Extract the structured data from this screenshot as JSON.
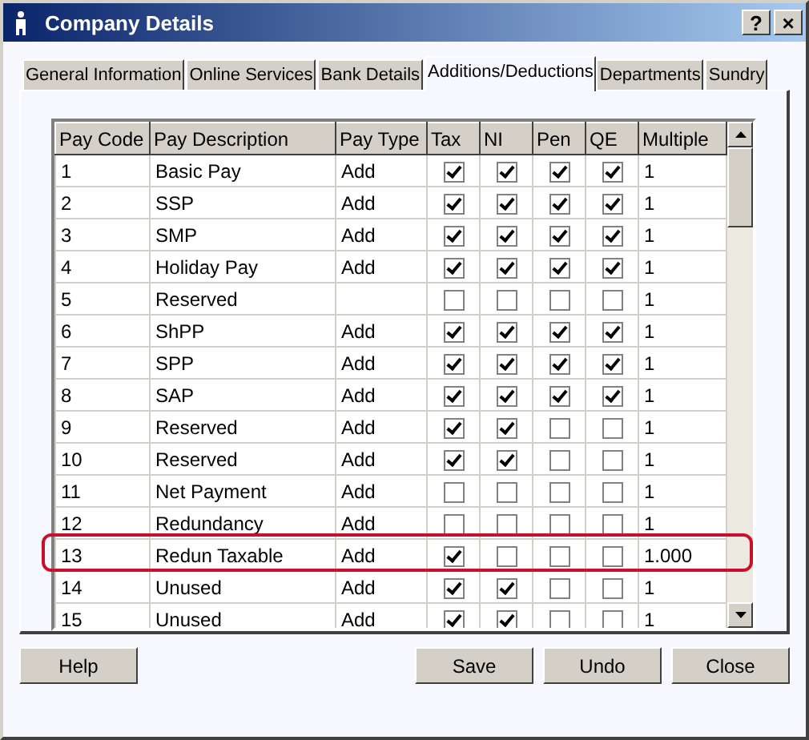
{
  "window": {
    "title": "Company Details",
    "buttons": [
      "?",
      "×"
    ]
  },
  "tabs": [
    {
      "label": "General Information",
      "selected": false
    },
    {
      "label": "Online Services",
      "selected": false
    },
    {
      "label": "Bank Details",
      "selected": false
    },
    {
      "label": "Additions/Deductions",
      "selected": true
    },
    {
      "label": "Departments",
      "selected": false
    },
    {
      "label": "Sundry",
      "selected": false
    }
  ],
  "table": {
    "columns": [
      "Pay Code",
      "Pay Description",
      "Pay Type",
      "Tax",
      "NI",
      "Pen",
      "QE",
      "Multiple"
    ],
    "rows": [
      {
        "code": "1",
        "description": "Basic Pay",
        "type": "Add",
        "tax": true,
        "ni": true,
        "pen": true,
        "qe": true,
        "multiple": "1",
        "highlighted": false
      },
      {
        "code": "2",
        "description": "SSP",
        "type": "Add",
        "tax": true,
        "ni": true,
        "pen": true,
        "qe": true,
        "multiple": "1",
        "highlighted": false
      },
      {
        "code": "3",
        "description": "SMP",
        "type": "Add",
        "tax": true,
        "ni": true,
        "pen": true,
        "qe": true,
        "multiple": "1",
        "highlighted": false
      },
      {
        "code": "4",
        "description": "Holiday Pay",
        "type": "Add",
        "tax": true,
        "ni": true,
        "pen": true,
        "qe": true,
        "multiple": "1",
        "highlighted": false
      },
      {
        "code": "5",
        "description": "Reserved",
        "tax": false,
        "ni": false,
        "pen": false,
        "qe": false,
        "multiple": "1",
        "highlighted": false
      },
      {
        "code": "6",
        "description": "ShPP",
        "type": "Add",
        "tax": true,
        "ni": true,
        "pen": true,
        "qe": true,
        "multiple": "1",
        "highlighted": false
      },
      {
        "code": "7",
        "description": "SPP",
        "type": "Add",
        "tax": true,
        "ni": true,
        "pen": true,
        "qe": true,
        "multiple": "1",
        "highlighted": false
      },
      {
        "code": "8",
        "description": "SAP",
        "type": "Add",
        "tax": true,
        "ni": true,
        "pen": true,
        "qe": true,
        "multiple": "1",
        "highlighted": false
      },
      {
        "code": "9",
        "description": "Reserved",
        "type": "Add",
        "tax": true,
        "ni": true,
        "pen": false,
        "qe": false,
        "multiple": "1",
        "highlighted": false
      },
      {
        "code": "10",
        "description": "Reserved",
        "type": "Add",
        "tax": true,
        "ni": true,
        "pen": false,
        "qe": false,
        "multiple": "1",
        "highlighted": false
      },
      {
        "code": "11",
        "description": "Net Payment",
        "type": "Add",
        "tax": false,
        "ni": false,
        "pen": false,
        "qe": false,
        "multiple": "1",
        "highlighted": false
      },
      {
        "code": "12",
        "description": "Redundancy",
        "type": "Add",
        "tax": false,
        "ni": false,
        "pen": false,
        "qe": false,
        "multiple": "1",
        "highlighted": false
      },
      {
        "code": "13",
        "description": "Redun Taxable",
        "type": "Add",
        "tax": true,
        "ni": false,
        "pen": false,
        "qe": false,
        "multiple": "1.000",
        "highlighted": true
      },
      {
        "code": "14",
        "description": "Unused",
        "type": "Add",
        "tax": true,
        "ni": true,
        "pen": false,
        "qe": false,
        "multiple": "1",
        "highlighted": false
      },
      {
        "code": "15",
        "description": "Unused",
        "type": "Add",
        "tax": true,
        "ni": true,
        "pen": false,
        "qe": false,
        "multiple": "1",
        "highlighted": false
      }
    ]
  },
  "buttons": [
    {
      "label": "Help",
      "kind": "left"
    },
    {
      "label": "Save",
      "kind": "right"
    },
    {
      "label": "Undo",
      "kind": "right"
    },
    {
      "label": "Close",
      "kind": "right"
    }
  ]
}
